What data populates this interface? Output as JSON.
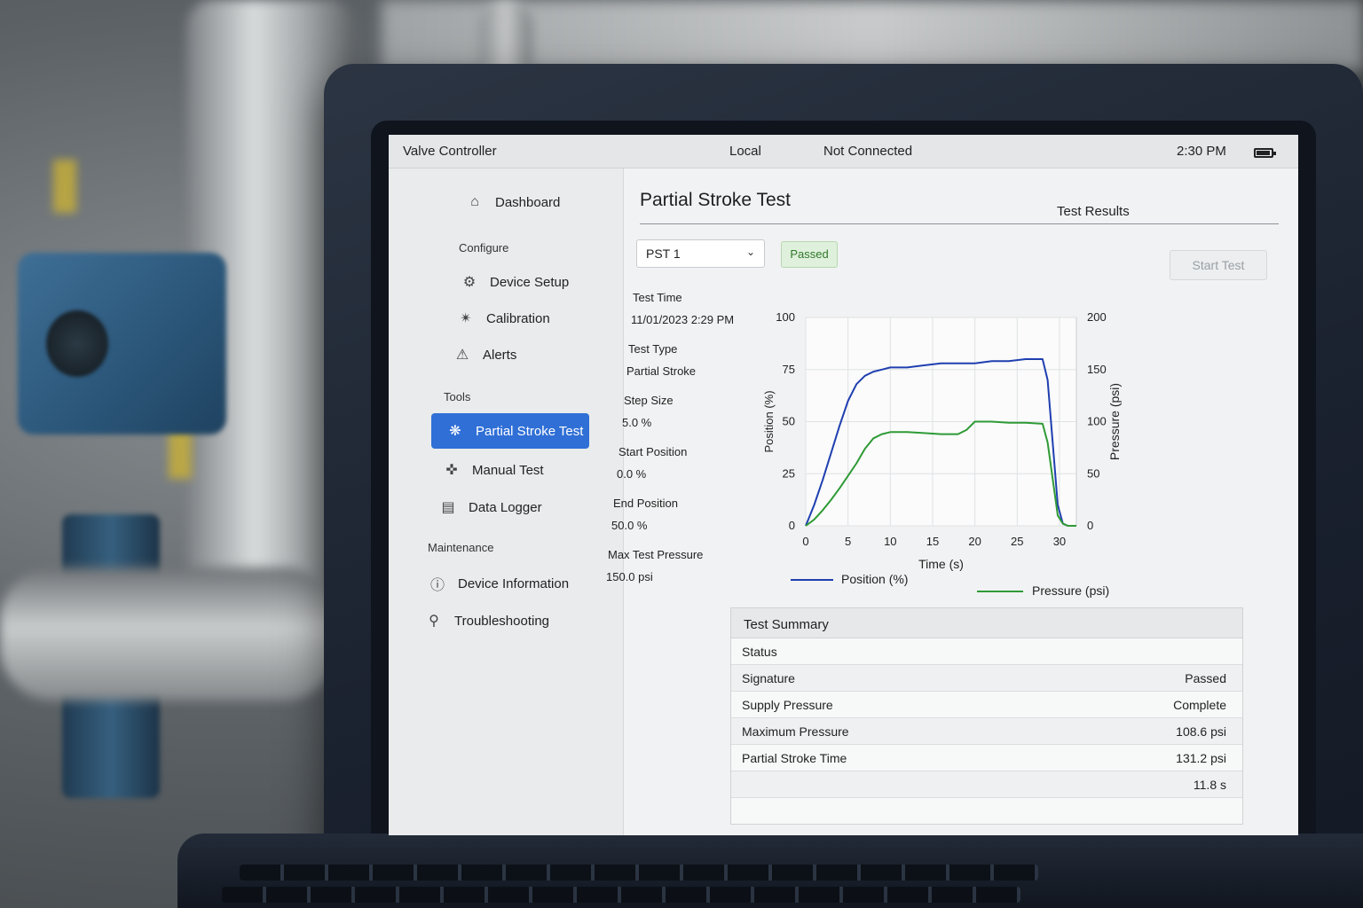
{
  "topbar": {
    "app_title": "Valve Controller",
    "mode": "Local",
    "connection": "Not Connected",
    "time": "2:30 PM"
  },
  "sidebar": {
    "items": [
      {
        "label": "Dashboard",
        "icon": "home-icon"
      },
      {
        "label": "Device Setup",
        "icon": "gear-icon"
      },
      {
        "label": "Calibration",
        "icon": "wrench-icon"
      },
      {
        "label": "Alerts",
        "icon": "warning-icon"
      },
      {
        "label": "Partial Stroke Test",
        "icon": "valve-icon",
        "active": true
      },
      {
        "label": "Manual Test",
        "icon": "hand-icon"
      },
      {
        "label": "Data Logger",
        "icon": "clipboard-icon"
      },
      {
        "label": "Device Information",
        "icon": "info-icon"
      },
      {
        "label": "Troubleshooting",
        "icon": "wrench-search-icon"
      }
    ],
    "sections": {
      "configure": "Configure",
      "tools": "Tools",
      "maintenance": "Maintenance"
    }
  },
  "main": {
    "page_title": "Partial Stroke Test",
    "results_title": "Test Results",
    "test_select": "PST 1",
    "status_badge": "Passed",
    "start_button": "Start Test",
    "fields": [
      {
        "label": "Test Time",
        "value": "11/01/2023 2:29 PM"
      },
      {
        "label": "Test Type",
        "value": "Partial Stroke"
      },
      {
        "label": "Step Size",
        "value": "5.0 %"
      },
      {
        "label": "Start Position",
        "value": "0.0 %"
      },
      {
        "label": "End Position",
        "value": "50.0 %"
      },
      {
        "label": "Max Test Pressure",
        "value": "150.0 psi"
      }
    ]
  },
  "summary": {
    "title": "Test Summary",
    "rows": [
      {
        "label": "Status",
        "value": ""
      },
      {
        "label": "Signature",
        "value": "Passed"
      },
      {
        "label": "Supply Pressure",
        "value": "Complete"
      },
      {
        "label": "Maximum Pressure",
        "value": "108.6 psi"
      },
      {
        "label": "Partial Stroke Time",
        "value": "131.2 psi"
      },
      {
        "label": "",
        "value": "11.8 s"
      }
    ]
  },
  "colors": {
    "position": "#1f3fb0",
    "pressure": "#2e9a35",
    "accent": "#2f6fd6"
  },
  "chart_data": {
    "type": "line",
    "xlabel": "Time (s)",
    "ylabel": "Position (%)",
    "y2label": "Pressure (psi)",
    "xlim": [
      0,
      32
    ],
    "ylim": [
      0,
      100
    ],
    "y2lim": [
      0,
      200
    ],
    "xticks": [
      0,
      5,
      10,
      15,
      20,
      25,
      30
    ],
    "yticks": [
      0,
      25,
      50,
      75,
      100
    ],
    "y2ticks": [
      0,
      50,
      100,
      150,
      200
    ],
    "grid": true,
    "series": [
      {
        "name": "Position (%)",
        "axis": "left",
        "x": [
          0,
          1,
          2,
          3,
          4,
          5,
          6,
          7,
          8,
          9,
          10,
          12,
          14,
          16,
          18,
          20,
          22,
          24,
          26,
          28,
          28.6,
          29.2,
          29.8,
          30.4,
          31,
          32
        ],
        "y": [
          0,
          10,
          22,
          35,
          48,
          60,
          68,
          72,
          74,
          75,
          76,
          76,
          77,
          78,
          78,
          78,
          79,
          79,
          80,
          80,
          70,
          40,
          10,
          1,
          0,
          0
        ]
      },
      {
        "name": "Pressure (psi)",
        "axis": "right",
        "x": [
          0,
          1,
          2,
          3,
          4,
          5,
          6,
          7,
          8,
          9,
          10,
          12,
          14,
          16,
          18,
          19,
          20,
          22,
          24,
          26,
          28,
          28.6,
          29.2,
          29.8,
          30.4,
          31,
          32
        ],
        "y": [
          0,
          6,
          15,
          25,
          36,
          48,
          60,
          74,
          84,
          88,
          90,
          90,
          89,
          88,
          88,
          92,
          100,
          100,
          99,
          99,
          98,
          80,
          45,
          10,
          2,
          0,
          0
        ]
      }
    ]
  }
}
